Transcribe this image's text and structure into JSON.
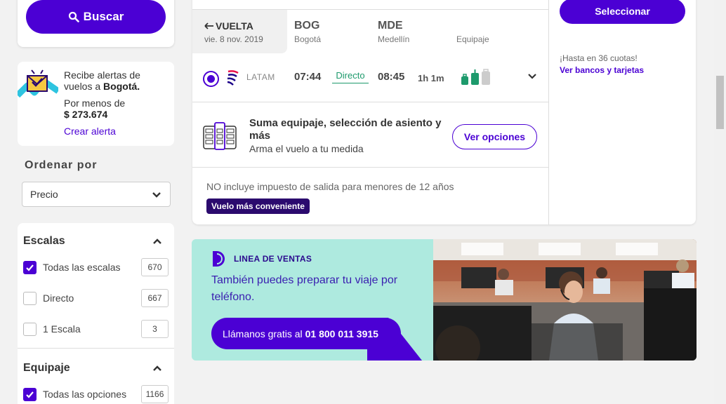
{
  "sidebar": {
    "search_label": "Buscar",
    "alert": {
      "line1": "Recibe alertas de",
      "line2_prefix": "vuelos a ",
      "line2_city": "Bogotá.",
      "price_label": "Por menos de",
      "price": "$ 273.674",
      "link": "Crear alerta"
    },
    "order_title": "Ordenar por",
    "order_value": "Precio",
    "filters": {
      "escalas_title": "Escalas",
      "escalas": [
        {
          "label": "Todas las escalas",
          "count": "670",
          "checked": true
        },
        {
          "label": "Directo",
          "count": "667",
          "checked": false
        },
        {
          "label": "1 Escala",
          "count": "3",
          "checked": false
        }
      ],
      "equipaje_title": "Equipaje",
      "equipaje": [
        {
          "label": "Todas las opciones",
          "count": "1166",
          "checked": true
        }
      ]
    }
  },
  "flight": {
    "direction": "VUELTA",
    "date": "vie. 8 nov. 2019",
    "origin_code": "BOG",
    "origin_city": "Bogotá",
    "dest_code": "MDE",
    "dest_city": "Medellín",
    "baggage_header": "Equipaje",
    "airline": "LATAM",
    "depart": "07:44",
    "stops": "Directo",
    "arrive": "08:45",
    "duration": "1h 1m",
    "upsell_title": "Suma equipaje, selección de asiento y más",
    "upsell_sub": "Arma el vuelo a tu medida",
    "options_btn": "Ver opciones",
    "tax_note": "NO incluye impuesto de salida para menores de 12 años",
    "badge": "Vuelo más conveniente",
    "select_btn": "Seleccionar",
    "cuotas": "¡Hasta en 36 cuotas!",
    "banks_link": "Ver bancos y tarjetas"
  },
  "promo": {
    "label": "LINEA DE VENTAS",
    "text": "También puedes preparar tu viaje por teléfono.",
    "call_prefix": "Llámanos gratis al",
    "phone": "01 800 011 3915"
  },
  "colors": {
    "brand": "#4b00d4",
    "promo_bg": "#aeeadf",
    "direct_green": "#1d9a6c"
  }
}
